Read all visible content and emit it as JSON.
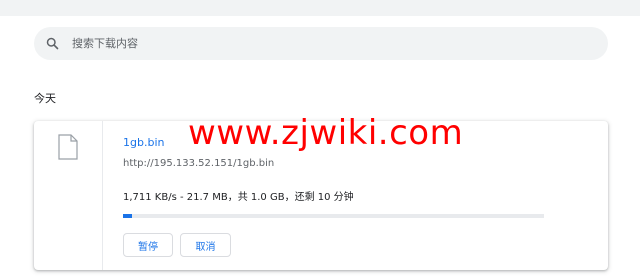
{
  "search": {
    "placeholder": "搜索下载内容"
  },
  "section": {
    "title": "今天"
  },
  "download": {
    "file_name": "1gb.bin",
    "url": "http://195.133.52.151/1gb.bin",
    "status": "1,711 KB/s - 21.7 MB，共 1.0 GB，还剩 10 分钟",
    "progress_fraction": 0.021,
    "pause_label": "暂停",
    "cancel_label": "取消"
  },
  "watermark": {
    "text": "www.zjwiki.com"
  },
  "colors": {
    "accent": "#1a73e8",
    "watermark": "#ff0000",
    "search_bg": "#f1f3f4"
  },
  "icons": {
    "search": "search-icon",
    "file": "file-icon"
  }
}
